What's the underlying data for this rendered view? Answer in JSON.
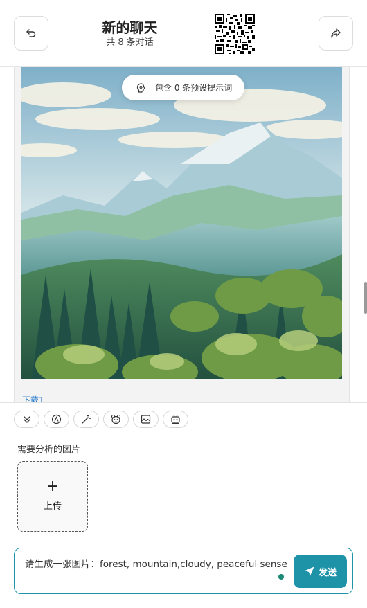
{
  "header": {
    "title": "新的聊天",
    "subtitle": "共 8 条对话",
    "back_icon": "return-icon",
    "share_icon": "share-icon"
  },
  "chat": {
    "prompt_pill": "包含 0 条预设提示词",
    "download_link": "下载1"
  },
  "toolbar": {
    "tools": [
      "collapse-icon",
      "model-switch-icon",
      "magic-wand-icon",
      "mask-icon",
      "image-icon",
      "robot-icon"
    ]
  },
  "input_area": {
    "image_label": "需要分析的图片",
    "upload_plus": "+",
    "upload_label": "上传",
    "input_value": "请生成一张图片：forest, mountain,cloudy, peaceful sense",
    "send_label": "发送"
  },
  "colors": {
    "accent": "#1e93a8",
    "status_dot": "#1b8a77",
    "link": "#1a73c8"
  }
}
